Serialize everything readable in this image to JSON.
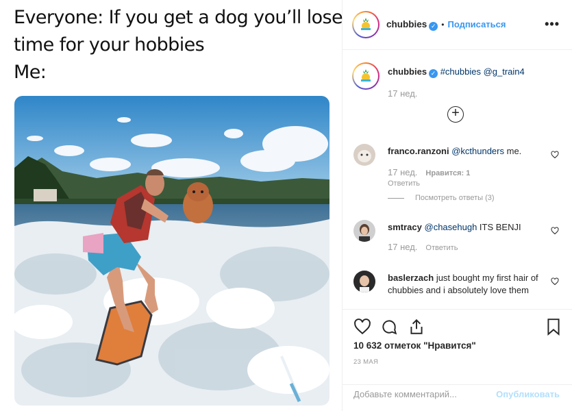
{
  "meme": {
    "line1": "Everyone: If you get a dog you’ll lose",
    "line2": "time for your hobbies",
    "line3": "Me:"
  },
  "header": {
    "username": "chubbies",
    "separator": "•",
    "follow_label": "Подписаться",
    "more_label": "•••"
  },
  "caption": {
    "username": "chubbies",
    "text": "#chubbies @g_train4",
    "time": "17 нед."
  },
  "load_more": "+",
  "comments": [
    {
      "username": "franco.ranzoni",
      "mention": "@kcthunders",
      "text": " me.",
      "time": "17 нед.",
      "likes": "Нравится: 1",
      "reply": "Ответить",
      "view_replies": "Посмотреть ответы (3)"
    },
    {
      "username": "smtracy",
      "mention": "@chasehugh",
      "text": " ITS BENJI",
      "time": "17 нед.",
      "reply": "Ответить"
    },
    {
      "username": "baslerzach",
      "mention": "",
      "text": " just bought my first hair of chubbies and i absolutely love them"
    }
  ],
  "stats": {
    "likes": "10 632 отметок \"Нравится\"",
    "date": "23 МАЯ"
  },
  "add_comment": {
    "placeholder": "Добавьте комментарий...",
    "publish": "Опубликовать"
  },
  "colors": {
    "accent": "#3897f0",
    "link": "#003569",
    "muted": "#999999"
  }
}
